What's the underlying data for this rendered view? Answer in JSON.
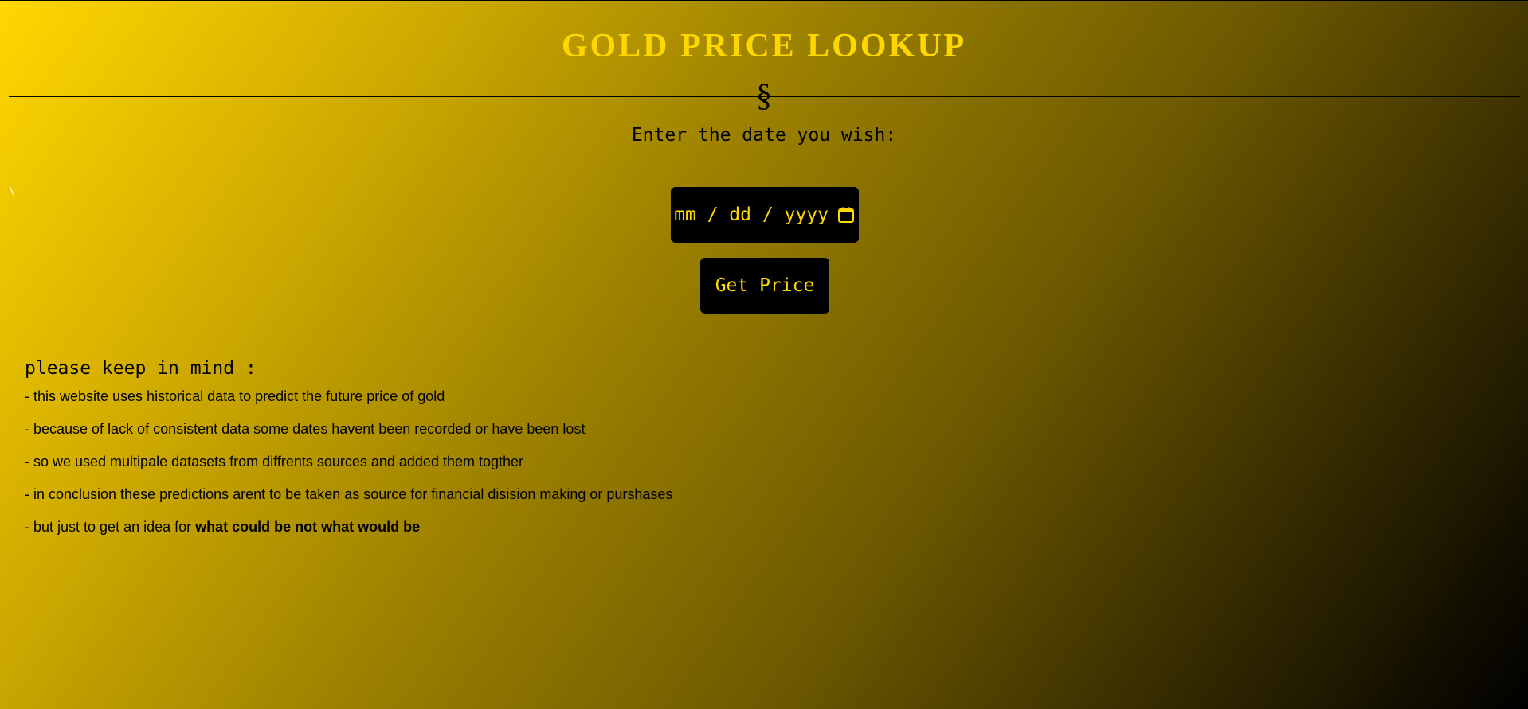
{
  "page": {
    "title": "GOLD PRICE LOOKUP",
    "divider_glyph": "§",
    "prompt": "Enter the date you wish:",
    "stray_char": "\\"
  },
  "date_input": {
    "placeholder": "mm / dd / yyyy",
    "icon": "calendar-icon"
  },
  "button": {
    "label": "Get Price"
  },
  "notice": {
    "heading": "please keep in mind :",
    "items": [
      "- this website uses historical data to predict the future price of gold",
      "- because of lack of consistent data some dates havent been recorded or have been lost",
      "- so we used multipale datasets from diffrents sources and added them togther",
      "- in conclusion these predictions arent to be taken as source for financial disision making or purshases"
    ],
    "last_item_prefix": "- but just to get an idea for ",
    "last_item_bold": "what could be not what would be"
  },
  "colors": {
    "gold": "#FFD700",
    "black": "#000000"
  }
}
